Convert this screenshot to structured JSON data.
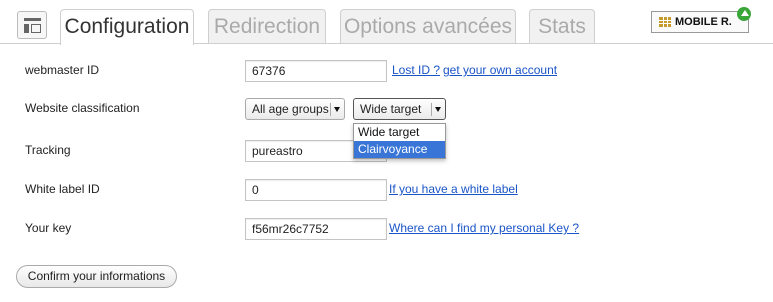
{
  "tabs": [
    {
      "label": "Configuration",
      "active": true
    },
    {
      "label": "Redirection",
      "active": false
    },
    {
      "label": "Options avancées",
      "active": false
    },
    {
      "label": "Stats",
      "active": false
    }
  ],
  "badge": {
    "label": "MOBILE R."
  },
  "form": {
    "webmaster": {
      "label": "webmaster ID",
      "value": "67376",
      "link1": "Lost ID ?",
      "link2": "get your own account"
    },
    "classification": {
      "label": "Website classification",
      "age_select": "All age groups",
      "target_select": "Wide target",
      "options": [
        "Wide target",
        "Clairvoyance"
      ],
      "highlighted_option": "Clairvoyance"
    },
    "tracking": {
      "label": "Tracking",
      "value": "pureastro"
    },
    "white_label": {
      "label": "White label ID",
      "value": "0",
      "link": "If you have a white label"
    },
    "key": {
      "label": "Your key",
      "value": "f56mr26c7752",
      "link": "Where can I find my personal Key ?"
    }
  },
  "confirm_label": "Confirm your informations",
  "colors": {
    "link": "#1a55c8",
    "highlight": "#3875d7"
  }
}
